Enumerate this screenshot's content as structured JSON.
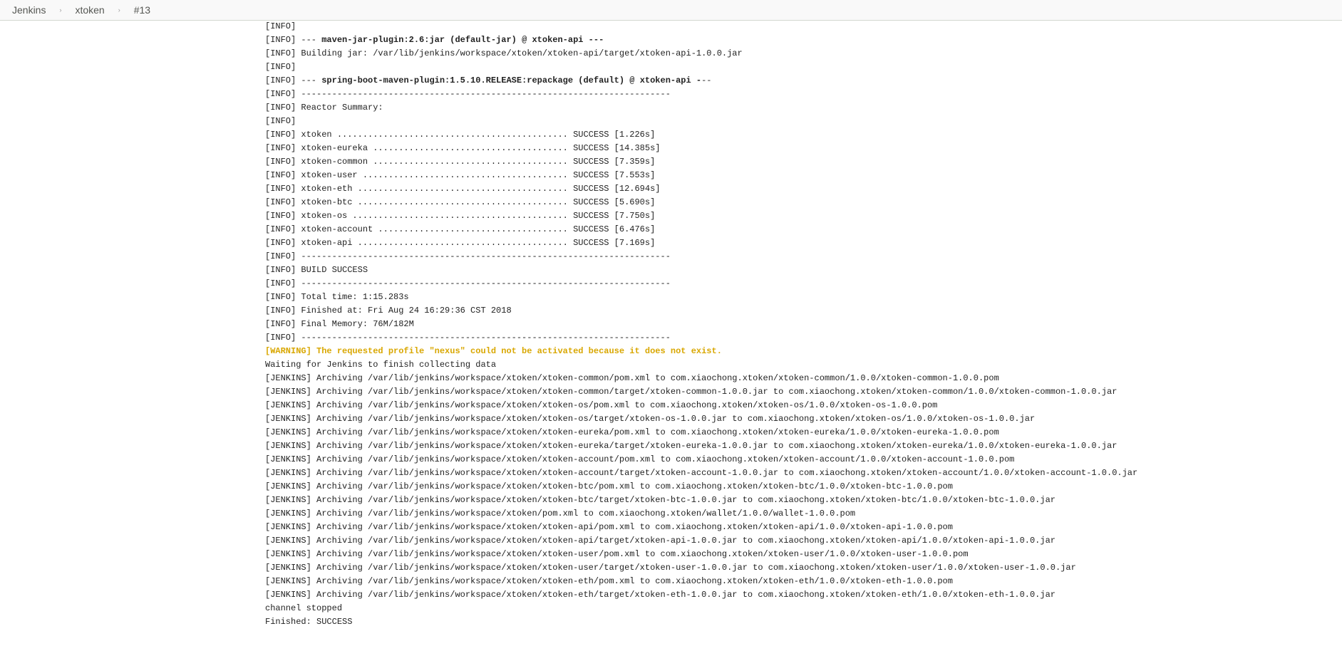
{
  "breadcrumb": {
    "items": [
      "Jenkins",
      "xtoken",
      "#13"
    ],
    "separator": "›"
  },
  "console": {
    "lines": [
      {
        "text": "[INFO]",
        "style": "normal"
      },
      {
        "text": "[INFO] --- maven-jar-plugin:2.6:jar (default-jar) @ xtoken-api ---",
        "style": "normal",
        "bold_start": 11,
        "bold_end": 68
      },
      {
        "text": "[INFO] Building jar: /var/lib/jenkins/workspace/xtoken/xtoken-api/target/xtoken-api-1.0.0.jar",
        "style": "normal"
      },
      {
        "text": "[INFO]",
        "style": "normal"
      },
      {
        "text": "[INFO] --- spring-boot-maven-plugin:1.5.10.RELEASE:repackage (default) @ xtoken-api ---",
        "style": "normal",
        "bold_start": 11,
        "bold_end": 85
      },
      {
        "text": "[INFO] ------------------------------------------------------------------------",
        "style": "normal"
      },
      {
        "text": "[INFO] Reactor Summary:",
        "style": "normal"
      },
      {
        "text": "[INFO]",
        "style": "normal"
      },
      {
        "text": "[INFO] xtoken ............................................. SUCCESS [1.226s]",
        "style": "normal"
      },
      {
        "text": "[INFO] xtoken-eureka ...................................... SUCCESS [14.385s]",
        "style": "normal"
      },
      {
        "text": "[INFO] xtoken-common ...................................... SUCCESS [7.359s]",
        "style": "normal"
      },
      {
        "text": "[INFO] xtoken-user ........................................ SUCCESS [7.553s]",
        "style": "normal"
      },
      {
        "text": "[INFO] xtoken-eth ......................................... SUCCESS [12.694s]",
        "style": "normal"
      },
      {
        "text": "[INFO] xtoken-btc ......................................... SUCCESS [5.690s]",
        "style": "normal"
      },
      {
        "text": "[INFO] xtoken-os .......................................... SUCCESS [7.750s]",
        "style": "normal"
      },
      {
        "text": "[INFO] xtoken-account ..................................... SUCCESS [6.476s]",
        "style": "normal"
      },
      {
        "text": "[INFO] xtoken-api ......................................... SUCCESS [7.169s]",
        "style": "normal"
      },
      {
        "text": "[INFO] ------------------------------------------------------------------------",
        "style": "normal"
      },
      {
        "text": "[INFO] BUILD SUCCESS",
        "style": "normal"
      },
      {
        "text": "[INFO] ------------------------------------------------------------------------",
        "style": "normal"
      },
      {
        "text": "[INFO] Total time: 1:15.283s",
        "style": "normal"
      },
      {
        "text": "[INFO] Finished at: Fri Aug 24 16:29:36 CST 2018",
        "style": "normal"
      },
      {
        "text": "[INFO] Final Memory: 76M/182M",
        "style": "normal"
      },
      {
        "text": "[INFO] ------------------------------------------------------------------------",
        "style": "normal"
      },
      {
        "text": "[WARNING] The requested profile \"nexus\" could not be activated because it does not exist.",
        "style": "warn"
      },
      {
        "text": "Waiting for Jenkins to finish collecting data",
        "style": "normal"
      },
      {
        "text": "[JENKINS] Archiving /var/lib/jenkins/workspace/xtoken/xtoken-common/pom.xml to com.xiaochong.xtoken/xtoken-common/1.0.0/xtoken-common-1.0.0.pom",
        "style": "normal"
      },
      {
        "text": "[JENKINS] Archiving /var/lib/jenkins/workspace/xtoken/xtoken-common/target/xtoken-common-1.0.0.jar to com.xiaochong.xtoken/xtoken-common/1.0.0/xtoken-common-1.0.0.jar",
        "style": "normal"
      },
      {
        "text": "[JENKINS] Archiving /var/lib/jenkins/workspace/xtoken/xtoken-os/pom.xml to com.xiaochong.xtoken/xtoken-os/1.0.0/xtoken-os-1.0.0.pom",
        "style": "normal"
      },
      {
        "text": "[JENKINS] Archiving /var/lib/jenkins/workspace/xtoken/xtoken-os/target/xtoken-os-1.0.0.jar to com.xiaochong.xtoken/xtoken-os/1.0.0/xtoken-os-1.0.0.jar",
        "style": "normal"
      },
      {
        "text": "[JENKINS] Archiving /var/lib/jenkins/workspace/xtoken/xtoken-eureka/pom.xml to com.xiaochong.xtoken/xtoken-eureka/1.0.0/xtoken-eureka-1.0.0.pom",
        "style": "normal"
      },
      {
        "text": "[JENKINS] Archiving /var/lib/jenkins/workspace/xtoken/xtoken-eureka/target/xtoken-eureka-1.0.0.jar to com.xiaochong.xtoken/xtoken-eureka/1.0.0/xtoken-eureka-1.0.0.jar",
        "style": "normal"
      },
      {
        "text": "[JENKINS] Archiving /var/lib/jenkins/workspace/xtoken/xtoken-account/pom.xml to com.xiaochong.xtoken/xtoken-account/1.0.0/xtoken-account-1.0.0.pom",
        "style": "normal"
      },
      {
        "text": "[JENKINS] Archiving /var/lib/jenkins/workspace/xtoken/xtoken-account/target/xtoken-account-1.0.0.jar to com.xiaochong.xtoken/xtoken-account/1.0.0/xtoken-account-1.0.0.jar",
        "style": "normal"
      },
      {
        "text": "[JENKINS] Archiving /var/lib/jenkins/workspace/xtoken/xtoken-btc/pom.xml to com.xiaochong.xtoken/xtoken-btc/1.0.0/xtoken-btc-1.0.0.pom",
        "style": "normal"
      },
      {
        "text": "[JENKINS] Archiving /var/lib/jenkins/workspace/xtoken/xtoken-btc/target/xtoken-btc-1.0.0.jar to com.xiaochong.xtoken/xtoken-btc/1.0.0/xtoken-btc-1.0.0.jar",
        "style": "normal"
      },
      {
        "text": "[JENKINS] Archiving /var/lib/jenkins/workspace/xtoken/pom.xml to com.xiaochong.xtoken/wallet/1.0.0/wallet-1.0.0.pom",
        "style": "normal"
      },
      {
        "text": "[JENKINS] Archiving /var/lib/jenkins/workspace/xtoken/xtoken-api/pom.xml to com.xiaochong.xtoken/xtoken-api/1.0.0/xtoken-api-1.0.0.pom",
        "style": "normal"
      },
      {
        "text": "[JENKINS] Archiving /var/lib/jenkins/workspace/xtoken/xtoken-api/target/xtoken-api-1.0.0.jar to com.xiaochong.xtoken/xtoken-api/1.0.0/xtoken-api-1.0.0.jar",
        "style": "normal"
      },
      {
        "text": "[JENKINS] Archiving /var/lib/jenkins/workspace/xtoken/xtoken-user/pom.xml to com.xiaochong.xtoken/xtoken-user/1.0.0/xtoken-user-1.0.0.pom",
        "style": "normal"
      },
      {
        "text": "[JENKINS] Archiving /var/lib/jenkins/workspace/xtoken/xtoken-user/target/xtoken-user-1.0.0.jar to com.xiaochong.xtoken/xtoken-user/1.0.0/xtoken-user-1.0.0.jar",
        "style": "normal"
      },
      {
        "text": "[JENKINS] Archiving /var/lib/jenkins/workspace/xtoken/xtoken-eth/pom.xml to com.xiaochong.xtoken/xtoken-eth/1.0.0/xtoken-eth-1.0.0.pom",
        "style": "normal"
      },
      {
        "text": "[JENKINS] Archiving /var/lib/jenkins/workspace/xtoken/xtoken-eth/target/xtoken-eth-1.0.0.jar to com.xiaochong.xtoken/xtoken-eth/1.0.0/xtoken-eth-1.0.0.jar",
        "style": "normal"
      },
      {
        "text": "channel stopped",
        "style": "normal"
      },
      {
        "text": "Finished: SUCCESS",
        "style": "normal"
      }
    ]
  },
  "colors": {
    "warning": "#d9a700",
    "text": "#222222",
    "breadcrumb_bg": "#f9f9f9"
  }
}
